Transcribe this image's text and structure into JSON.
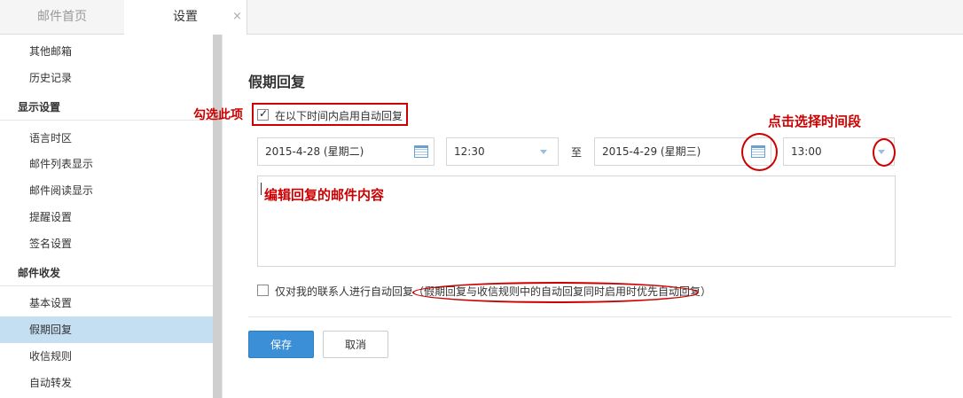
{
  "tabs": {
    "home": "邮件首页",
    "settings": "设置",
    "close_glyph": "×"
  },
  "sidebar": {
    "items": [
      {
        "label": "其他邮箱",
        "type": "item"
      },
      {
        "label": "历史记录",
        "type": "item"
      },
      {
        "label": "显示设置",
        "type": "head"
      },
      {
        "label": "语言时区",
        "type": "item"
      },
      {
        "label": "邮件列表显示",
        "type": "item"
      },
      {
        "label": "邮件阅读显示",
        "type": "item"
      },
      {
        "label": "提醒设置",
        "type": "item"
      },
      {
        "label": "签名设置",
        "type": "item"
      },
      {
        "label": "邮件收发",
        "type": "head"
      },
      {
        "label": "基本设置",
        "type": "item"
      },
      {
        "label": "假期回复",
        "type": "item",
        "active": true
      },
      {
        "label": "收信规则",
        "type": "item"
      },
      {
        "label": "自动转发",
        "type": "item"
      }
    ]
  },
  "main": {
    "title": "假期回复",
    "enable_label": "在以下时间内启用自动回复",
    "enable_checked": true,
    "start_date": "2015-4-28 (星期二)",
    "start_time": "12:30",
    "to_label": "至",
    "end_date": "2015-4-29 (星期三)",
    "end_time": "13:00",
    "contacts_only_label": "仅对我的联系人进行自动回复（假期回复与收信规则中的自动回复同时启用时优先自动回复）",
    "contacts_only_checked": false,
    "save_label": "保存",
    "cancel_label": "取消"
  },
  "annotations": {
    "check_hint": "勾选此项",
    "time_hint": "点击选择时间段",
    "content_hint": "编辑回复的邮件内容",
    "color": "#cc0000"
  },
  "colors": {
    "accent": "#3b8fd6",
    "active_item": "#c5dff2"
  }
}
